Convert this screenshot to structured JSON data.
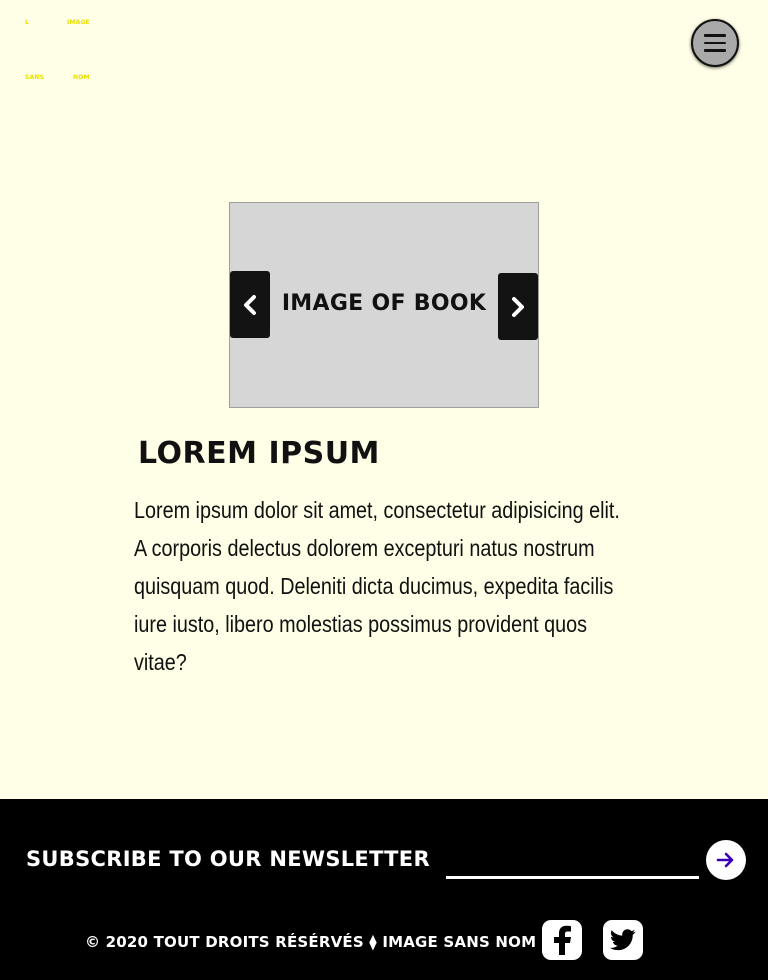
{
  "brand": {
    "logo_words": [
      "L",
      "IMAGE",
      "SANS",
      "NOM"
    ],
    "logo_color": "#e8e000"
  },
  "header": {
    "menu_icon": "hamburger-icon"
  },
  "carousel": {
    "label": "IMAGE OF BOOK",
    "prev_icon": "chevron-left-icon",
    "next_icon": "chevron-right-icon"
  },
  "article": {
    "title": "LOREM IPSUM",
    "body": "Lorem ipsum dolor sit amet, consectetur adipisicing elit. A corporis delectus dolorem excepturi natus nostrum quisquam quod. Deleniti dicta ducimus, expedita facilis iure iusto, libero molestias possimus provident quos vitae?"
  },
  "footer": {
    "newsletter_label": "SUBSCRIBE TO OUR NEWSLETTER",
    "newsletter_placeholder": "",
    "submit_icon": "arrow-right-icon",
    "submit_icon_color": "#3a00b8",
    "copyright": "© 2020 TOUT DROITS RÉSÉRVÉS ⧫ IMAGE SANS NOM",
    "social": [
      "facebook-icon",
      "twitter-icon"
    ]
  },
  "colors": {
    "background": "#fffee6",
    "footer": "#000000"
  }
}
